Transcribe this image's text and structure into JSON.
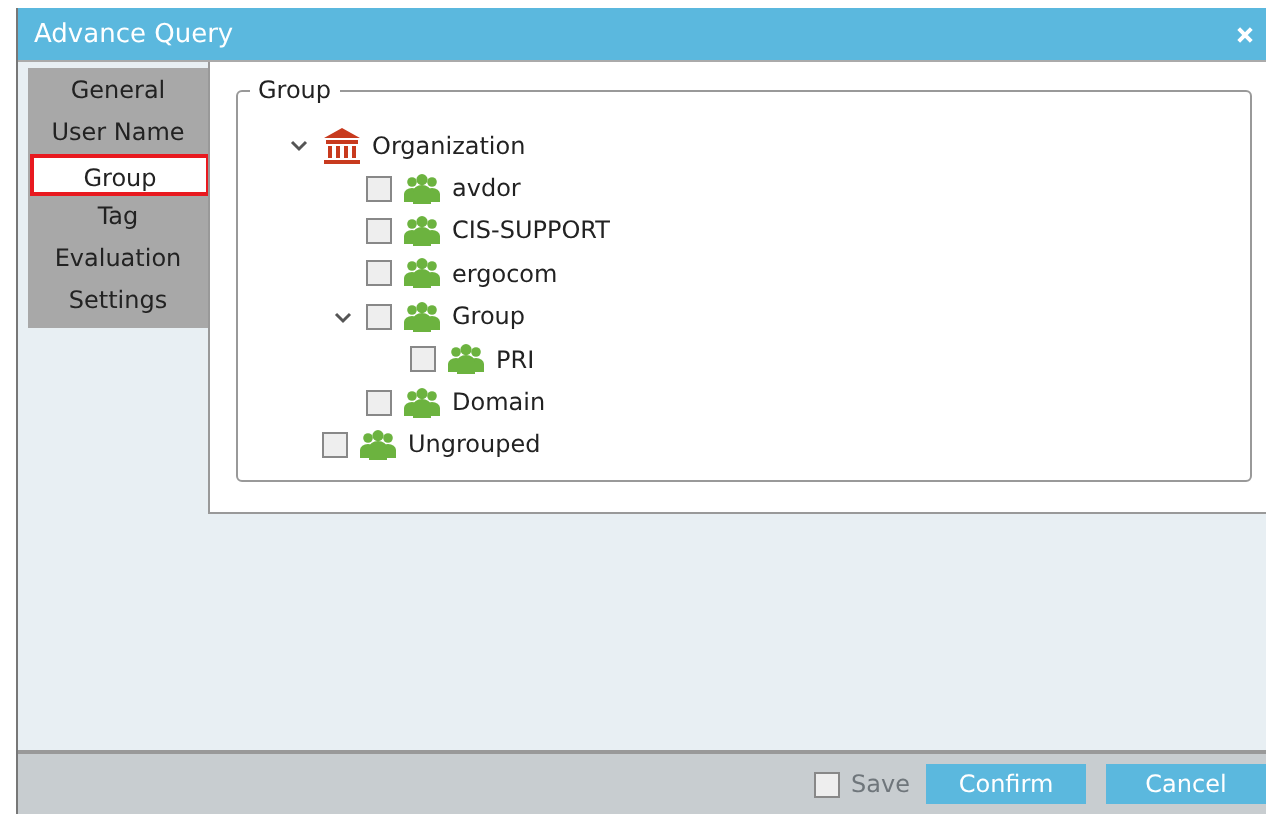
{
  "window": {
    "title": "Advance Query"
  },
  "sidebar": {
    "items": [
      {
        "label": "General",
        "selected": false
      },
      {
        "label": "User Name",
        "selected": false
      },
      {
        "label": "Group",
        "selected": true
      },
      {
        "label": "Tag",
        "selected": false
      },
      {
        "label": "Evaluation",
        "selected": false
      },
      {
        "label": "Settings",
        "selected": false
      }
    ]
  },
  "group_box": {
    "title": "Group",
    "tree": [
      {
        "label": "Organization",
        "kind": "organization",
        "expanded": true,
        "children": [
          {
            "label": "avdor",
            "kind": "group",
            "checked": false
          },
          {
            "label": "CIS-SUPPORT",
            "kind": "group",
            "checked": false
          },
          {
            "label": "ergocom",
            "kind": "group",
            "checked": false
          },
          {
            "label": "Group",
            "kind": "group",
            "checked": false,
            "expanded": true,
            "children": [
              {
                "label": "PRI",
                "kind": "group",
                "checked": false
              }
            ]
          },
          {
            "label": "Domain",
            "kind": "group",
            "checked": false
          }
        ]
      },
      {
        "label": "Ungrouped",
        "kind": "group",
        "checked": false
      }
    ]
  },
  "footer": {
    "save": {
      "label": "Save",
      "checked": false
    },
    "buttons": [
      "Confirm",
      "Cancel"
    ]
  }
}
